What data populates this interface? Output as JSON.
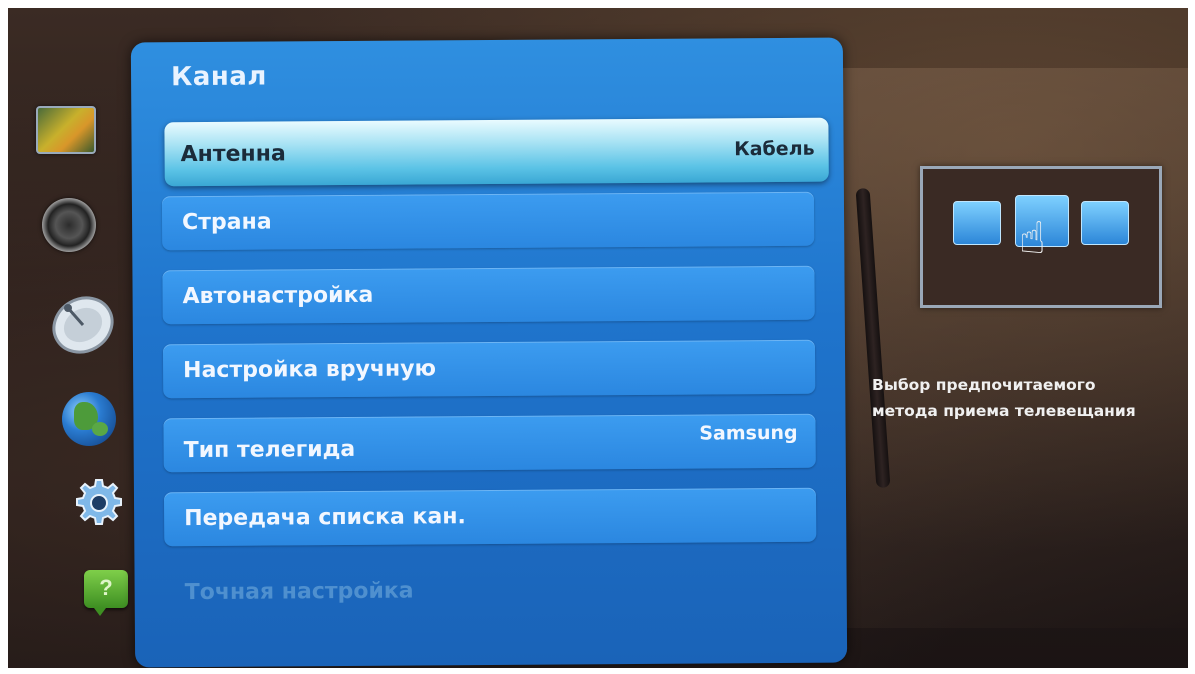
{
  "menu": {
    "title": "Канал",
    "items": [
      {
        "label": "Антенна",
        "value": "Кабель",
        "state": "selected"
      },
      {
        "label": "Страна",
        "value": "",
        "state": "normal"
      },
      {
        "label": "Автонастройка",
        "value": "",
        "state": "normal"
      },
      {
        "label": "Настройка вручную",
        "value": "",
        "state": "normal"
      },
      {
        "label": "Тип телегида",
        "value": "Samsung",
        "state": "normal"
      },
      {
        "label": "Передача списка кан.",
        "value": "",
        "state": "normal"
      },
      {
        "label": "Точная настройка",
        "value": "",
        "state": "disabled"
      }
    ]
  },
  "sidebar": {
    "icons": [
      "picture-icon",
      "sound-icon",
      "broadcast-icon",
      "network-icon",
      "system-icon",
      "support-icon"
    ],
    "help_glyph": "?"
  },
  "help_panel": {
    "description_line1": "Выбор предпочитаемого",
    "description_line2": "метода приема телевещания"
  },
  "colors": {
    "panel_blue": "#1f74cc",
    "item_blue": "#2b87e0",
    "selected_highlight": "#a9e3f4",
    "disabled_text": "#4f90cf"
  }
}
